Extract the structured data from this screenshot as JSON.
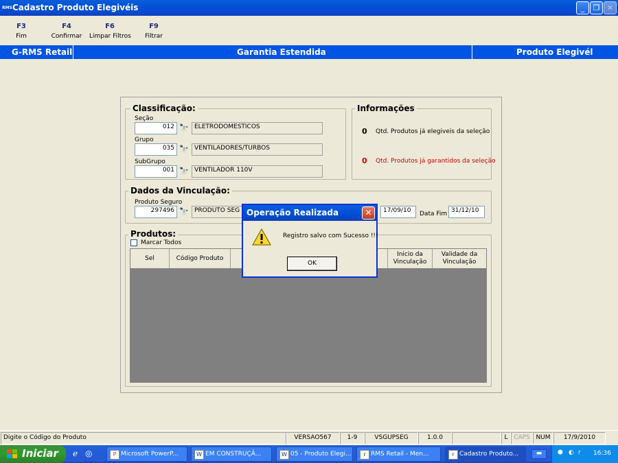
{
  "window": {
    "app_icon": "RMS",
    "title": "Cadastro Produto Elegivéis"
  },
  "fkeys": [
    {
      "key": "F3",
      "label": "Fim"
    },
    {
      "key": "F4",
      "label": "Confirmar"
    },
    {
      "key": "F6",
      "label": "Limpar Filtros"
    },
    {
      "key": "F9",
      "label": "Filtrar"
    }
  ],
  "header": {
    "left": "G-RMS Retail",
    "center": "Garantia Estendida",
    "right": "Produto Elegivél"
  },
  "classificacao": {
    "title": "Classificação:",
    "secao": {
      "label": "Seção",
      "code": "012",
      "desc": "ELETRODOMESTICOS"
    },
    "grupo": {
      "label": "Grupo",
      "code": "035",
      "desc": "VENTILADORES/TURBOS"
    },
    "subgrupo": {
      "label": "SubGrupo",
      "code": "001",
      "desc": "VENTILADOR 110V"
    }
  },
  "informacoes": {
    "title": "Informações",
    "elegiveis": {
      "count": "0",
      "text": "Qtd. Produtos já elegiveis da seleção"
    },
    "garantidos": {
      "count": "0",
      "text": "Qtd. Produtos já garantidos da seleção"
    }
  },
  "vinculacao": {
    "title": "Dados da Vinculação:",
    "produto_label": "Produto Seguro",
    "produto_code": "297496",
    "produto_desc": "PRODUTO SEG",
    "data_inicio": "17/09/10",
    "data_fim_label": "Data Fim",
    "data_fim": "31/12/10"
  },
  "produtos": {
    "title": "Produtos:",
    "marcar_todos": "Marcar Todos",
    "columns": [
      "Sel",
      "Código Produto",
      "Inicio da Vinculação",
      "Validade da Vinculação"
    ]
  },
  "dialog": {
    "title": "Operação Realizada",
    "message": "Registro salvo com Sucesso !!!",
    "ok": "OK"
  },
  "statusbar": {
    "hint": "Digite o Código do Produto",
    "versao": "VERSAO567",
    "range": "1-9",
    "module": "VSGUPSEG",
    "ver": "1.0.0",
    "l": "L",
    "caps": "CAPS",
    "num": "NUM",
    "date": "17/9/2010"
  },
  "taskbar": {
    "start": "Iniciar",
    "tasks": [
      "Microsoft PowerP...",
      "EM CONSTRUÇÃ...",
      "05 - Produto Elegi...",
      "RMS Retail - Men...",
      "Cadastro Produto..."
    ],
    "time": "16:36"
  },
  "colors": {
    "titlebar": "#0054E3",
    "header": "#0054E3",
    "red_count": "#CC0000",
    "grid_bg": "#808080"
  }
}
